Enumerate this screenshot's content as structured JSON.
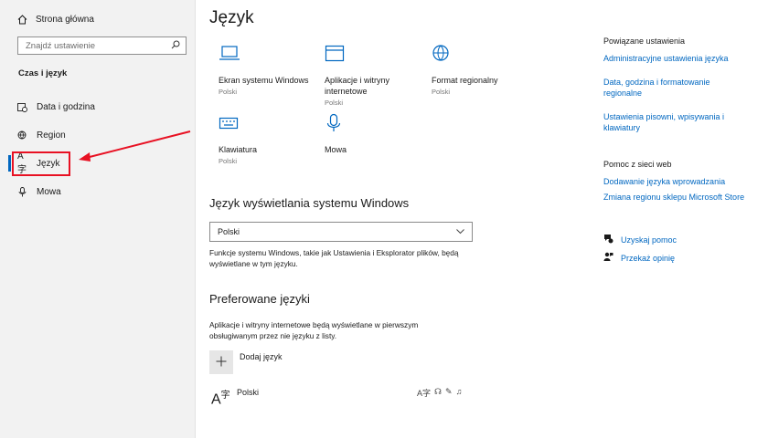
{
  "sidebar": {
    "home_label": "Strona główna",
    "search_placeholder": "Znajdź ustawienie",
    "section": "Czas i język",
    "items": [
      {
        "label": "Data i godzina",
        "icon": "calendar-clock-icon"
      },
      {
        "label": "Region",
        "icon": "globe-pin-icon"
      },
      {
        "label": "Język",
        "icon": "language-icon",
        "active": true
      },
      {
        "label": "Mowa",
        "icon": "microphone-icon"
      }
    ]
  },
  "main": {
    "title": "Język",
    "tiles": [
      {
        "label": "Ekran systemu Windows",
        "sub": "Polski",
        "icon": "laptop-icon"
      },
      {
        "label": "Aplikacje i witryny internetowe",
        "sub": "Polski",
        "icon": "window-icon"
      },
      {
        "label": "Format regionalny",
        "sub": "Polski",
        "icon": "globe-format-icon"
      },
      {
        "label": "Klawiatura",
        "sub": "Polski",
        "icon": "keyboard-icon"
      },
      {
        "label": "Mowa",
        "sub": "",
        "icon": "microphone-icon"
      }
    ],
    "display_lang_heading": "Język wyświetlania systemu Windows",
    "display_lang_value": "Polski",
    "display_lang_desc": "Funkcje systemu Windows, takie jak Ustawienia i Eksplorator plików, będą wyświetlane w tym języku.",
    "preferred_heading": "Preferowane języki",
    "preferred_desc": "Aplikacje i witryny internetowe będą wyświetlane w pierwszym obsługiwanym przez nie języku z listy.",
    "add_lang_label": "Dodaj język",
    "languages": [
      {
        "name": "Polski"
      }
    ]
  },
  "right": {
    "related_title": "Powiązane ustawienia",
    "related_links": [
      "Administracyjne ustawienia języka",
      "Data, godzina i formatowanie regionalne",
      "Ustawienia pisowni, wpisywania i klawiatury"
    ],
    "web_help_title": "Pomoc z sieci web",
    "web_links": [
      "Dodawanie języka wprowadzania",
      "Zmiana regionu sklepu Microsoft Store"
    ],
    "get_help": "Uzyskaj pomoc",
    "feedback": "Przekaż opinię"
  },
  "colors": {
    "accent": "#0067c0",
    "annotation": "#e81123"
  }
}
